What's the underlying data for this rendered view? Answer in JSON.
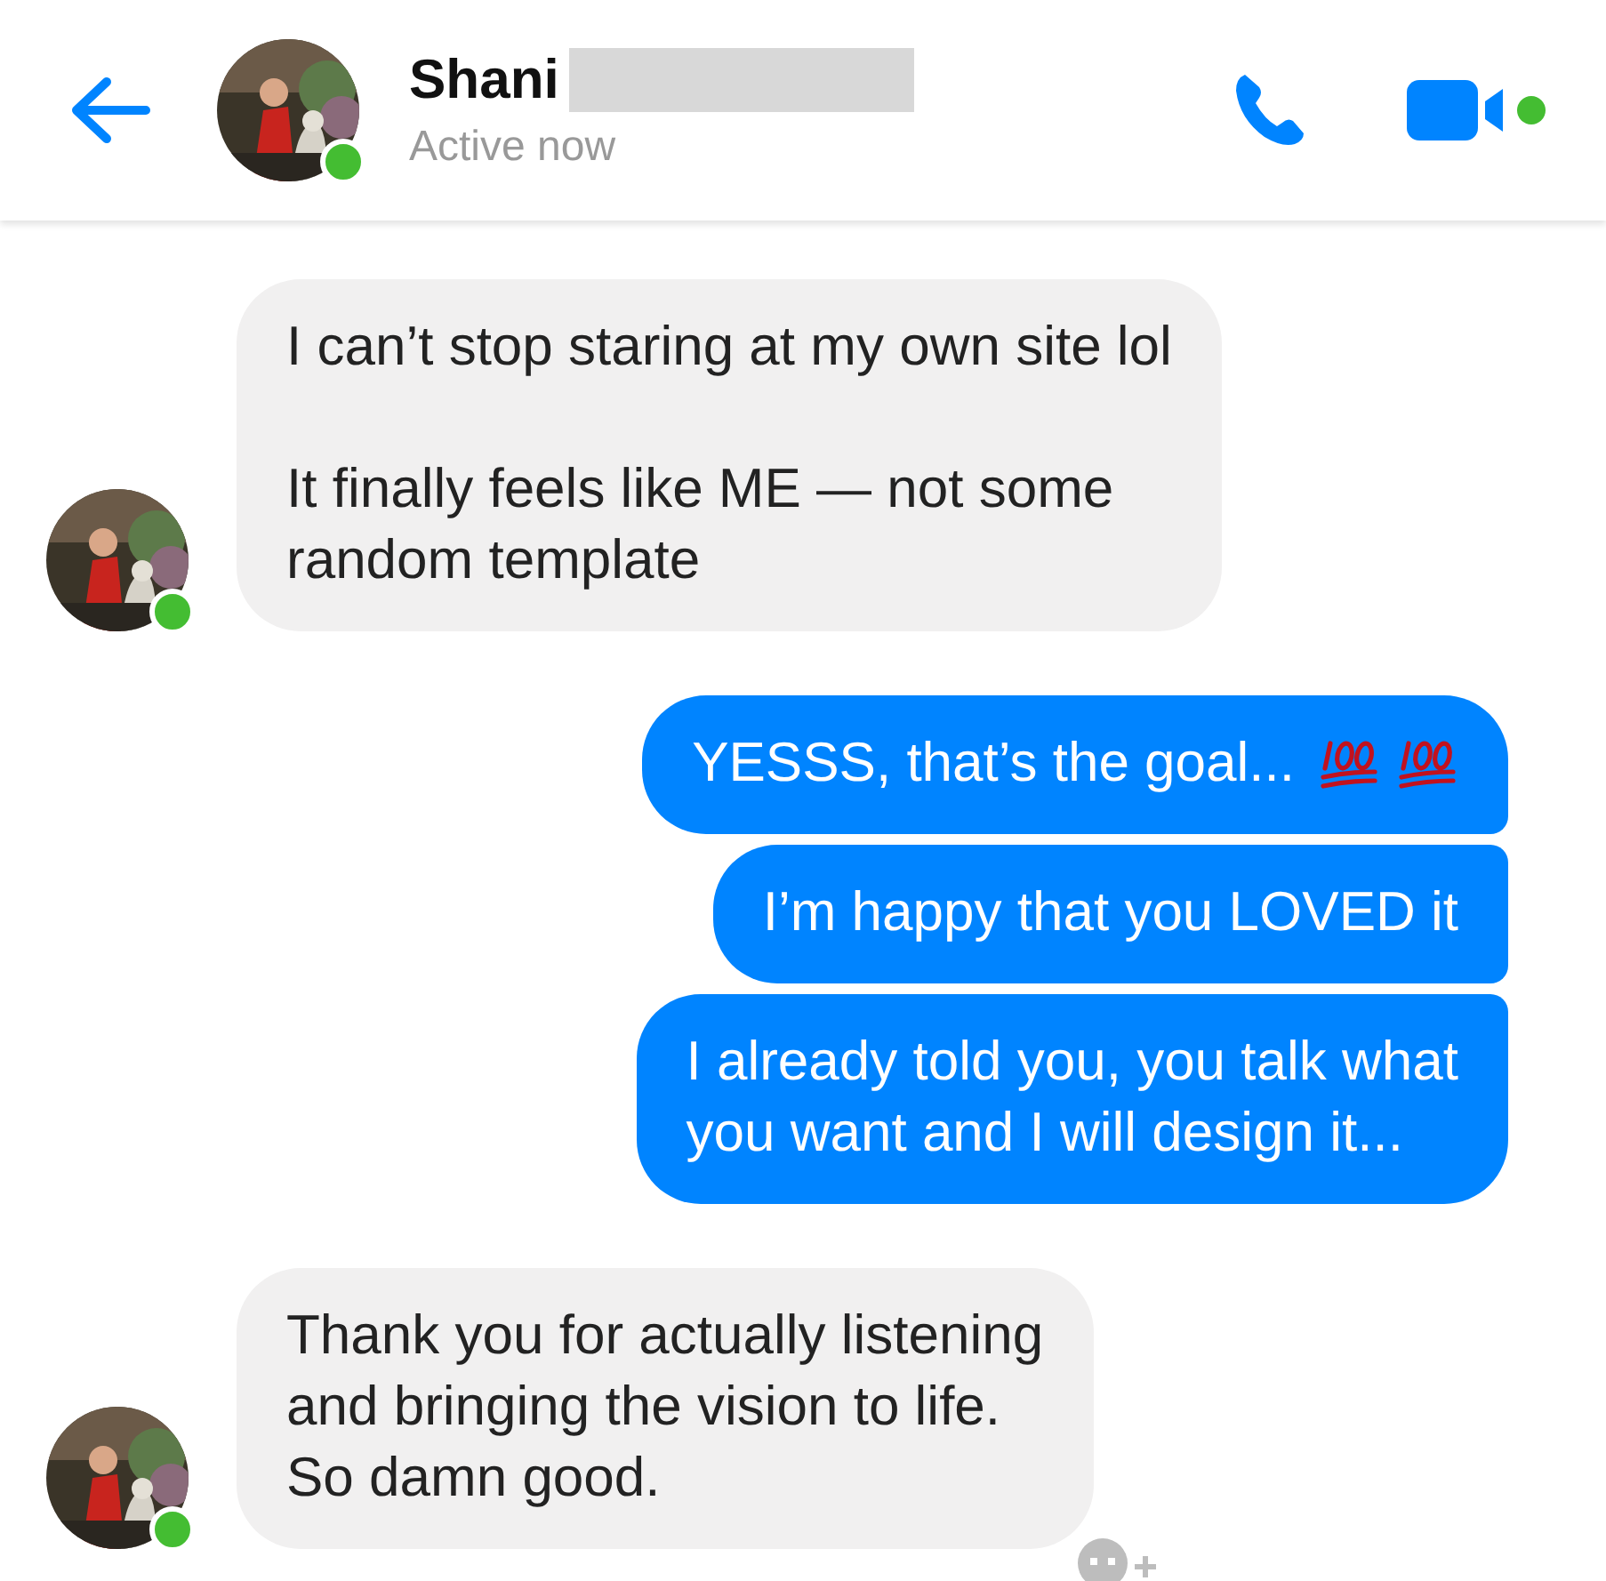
{
  "header": {
    "name": "Shani",
    "name_redacted": true,
    "status": "Active now",
    "online": true
  },
  "messages": [
    {
      "kind": "incoming",
      "text": "I can’t stop staring at my own site lol\n\nIt finally feels like ME — not some\nrandom template",
      "show_avatar": true,
      "online": true
    },
    {
      "kind": "outgoing",
      "text": "YESSS, that’s the goal...",
      "emojis": [
        {
          "kind": "hundred"
        },
        {
          "kind": "hundred"
        }
      ]
    },
    {
      "kind": "outgoing",
      "text": "I’m happy that you LOVED it"
    },
    {
      "kind": "outgoing",
      "text": "I already told you, you talk what\nyou want and I will design it..."
    },
    {
      "kind": "incoming",
      "text": "Thank you for actually listening\nand bringing the vision to life.\nSo damn good.",
      "show_avatar": true,
      "online": true,
      "reaction_button": true
    }
  ]
}
